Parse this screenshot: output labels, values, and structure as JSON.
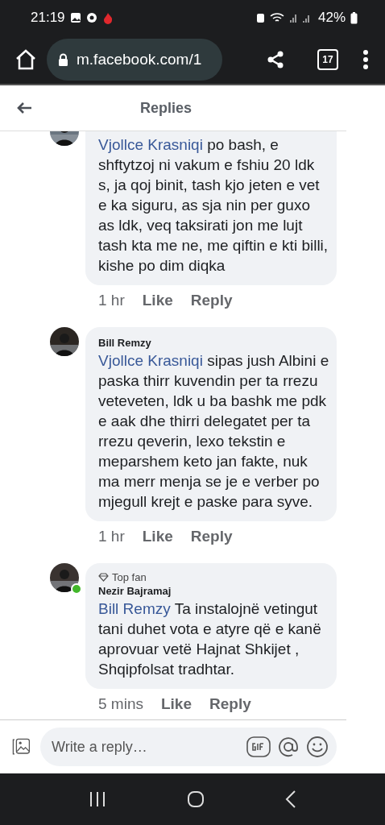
{
  "status_bar": {
    "time": "21:19",
    "battery": "42%"
  },
  "browser": {
    "url": "m.facebook.com/1",
    "tab_count": "17"
  },
  "header": {
    "title": "Replies"
  },
  "comments": [
    {
      "mention": "Vjollce Krasniqi",
      "text": " po bash, e shftytzoj ni vakum e fshiu 20 ldk s, ja qoj binit, tash kjo jeten e vet e ka siguru, as sja nin per guxo as ldk, veq taksirati jon me lujt tash kta me ne, me qiftin e kti billi, kishe po dim diqka",
      "time": "1 hr",
      "like": "Like",
      "reply": "Reply",
      "online": false
    },
    {
      "author": "Bill Remzy",
      "mention": "Vjollce Krasniqi",
      "text": " sipas jush Albini e paska thirr kuvendin per ta rrezu veteveten, ldk u ba bashk me pdk e aak dhe thirri delegatet per ta rrezu qeverin, lexo tekstin e meparshem keto jan fakte, nuk ma merr menja se je e verber po mjegull krejt e paske para syve.",
      "time": "1 hr",
      "like": "Like",
      "reply": "Reply",
      "online": false
    },
    {
      "badge": "Top fan",
      "author": "Nezir Bajramaj",
      "mention": "Bill Remzy",
      "text": " Ta instalojnë vetingut tani duhet vota e atyre që e kanë aprovuar vetë Hajnat Shkijet , Shqipfolsat tradhtar.",
      "time": "5 mins",
      "like": "Like",
      "reply": "Reply",
      "online": true
    }
  ],
  "composer": {
    "placeholder": "Write a reply…"
  }
}
